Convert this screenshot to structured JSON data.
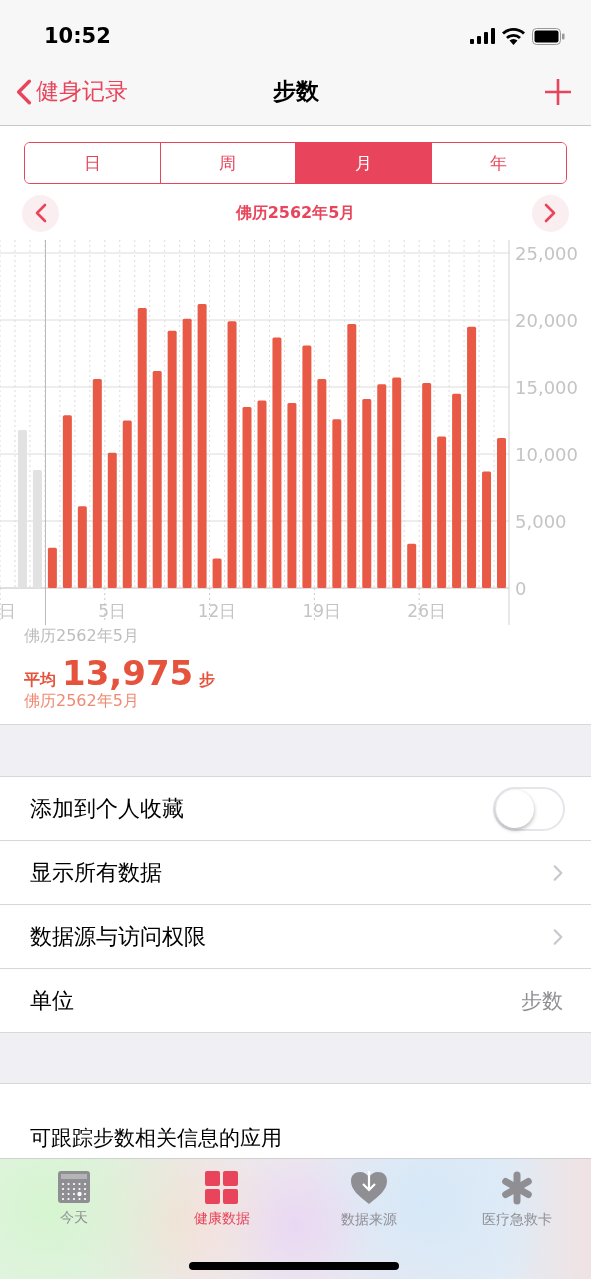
{
  "status_bar": {
    "time": "10:52"
  },
  "nav": {
    "back": "健身记录",
    "title": "步数"
  },
  "segments": [
    {
      "label": "日",
      "selected": false
    },
    {
      "label": "周",
      "selected": false
    },
    {
      "label": "月",
      "selected": true
    },
    {
      "label": "年",
      "selected": false
    }
  ],
  "period": {
    "label": "佛历2562年5月"
  },
  "chart": {
    "chart_data": {
      "type": "bar",
      "x": [
        -1,
        0,
        1,
        2,
        3,
        4,
        5,
        6,
        7,
        8,
        9,
        10,
        11,
        12,
        13,
        14,
        15,
        16,
        17,
        18,
        19,
        20,
        21,
        22,
        23,
        24,
        25,
        26,
        27,
        28,
        29,
        30,
        31
      ],
      "xlim": [
        -2.5,
        31.5
      ],
      "grid": true,
      "values": [
        11800,
        8800,
        3000,
        12900,
        6100,
        15600,
        10100,
        12500,
        20900,
        16200,
        19200,
        20100,
        21200,
        2200,
        19900,
        13500,
        14000,
        18700,
        13800,
        18100,
        15600,
        12600,
        19700,
        14100,
        15200,
        15700,
        3300,
        15300,
        11300,
        14500,
        19500,
        8700,
        11200
      ],
      "ylim": [
        0,
        25000
      ],
      "yticks": [
        {
          "value": 0,
          "label": "0"
        },
        {
          "value": 5000,
          "label": "5,000"
        },
        {
          "value": 10000,
          "label": "10,000"
        },
        {
          "value": 15000,
          "label": "15,000"
        },
        {
          "value": 20000,
          "label": "20,000"
        },
        {
          "value": 25000,
          "label": "25,000"
        }
      ],
      "xticks": [
        {
          "value": -2,
          "label": "日"
        },
        {
          "value": 5,
          "label": "5日"
        },
        {
          "value": 12,
          "label": "12日"
        },
        {
          "value": 19,
          "label": "19日"
        },
        {
          "value": 26,
          "label": "26日"
        }
      ]
    }
  },
  "summary": {
    "range": "佛历2562年5月",
    "avg_label": "平均",
    "value": "13,975",
    "unit": "步",
    "period": "佛历2562年5月"
  },
  "settings": [
    {
      "kind": "toggle",
      "label": "添加到个人收藏",
      "on": false
    },
    {
      "kind": "link",
      "label": "显示所有数据"
    },
    {
      "kind": "link",
      "label": "数据源与访问权限"
    },
    {
      "kind": "value",
      "label": "单位",
      "value": "步数"
    }
  ],
  "apps_section": {
    "title": "可跟踪步数相关信息的应用"
  },
  "tabbar": [
    {
      "kind": "calendar",
      "label": "今天",
      "selected": false
    },
    {
      "kind": "grid",
      "label": "健康数据",
      "selected": true
    },
    {
      "kind": "heart",
      "label": "数据来源",
      "selected": false
    },
    {
      "kind": "asterisk",
      "label": "医疗急救卡",
      "selected": false
    }
  ]
}
